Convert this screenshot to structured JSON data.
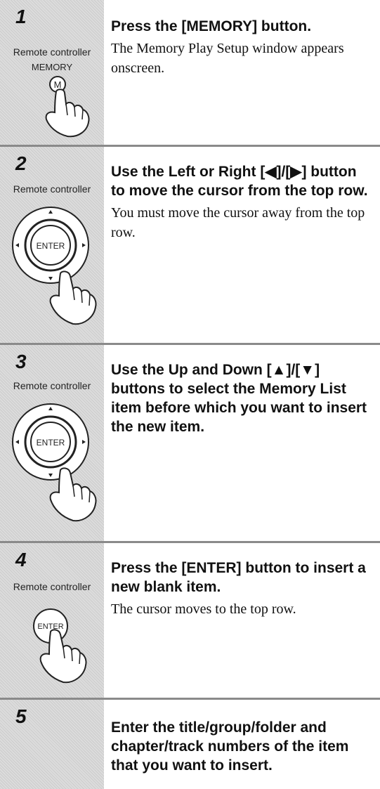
{
  "steps": [
    {
      "number": "1",
      "remote_label": "Remote controller",
      "button_label": "MEMORY",
      "button_letter": "M",
      "heading": "Press the [MEMORY] button.",
      "body": "The Memory Play Setup window appears onscreen."
    },
    {
      "number": "2",
      "remote_label": "Remote controller",
      "enter_label": "ENTER",
      "heading": "Use the Left or Right [◀]/[▶] button to move the cursor from the top row.",
      "body": "You must move the cursor away from the top row."
    },
    {
      "number": "3",
      "remote_label": "Remote controller",
      "enter_label": "ENTER",
      "heading": "Use the Up and Down [▲]/[▼] buttons to select the Memory List item before which you want to insert the new item.",
      "body": ""
    },
    {
      "number": "4",
      "remote_label": "Remote controller",
      "enter_label": "ENTER",
      "heading": "Press the [ENTER] button to insert a new blank item.",
      "body": "The cursor moves to the top row."
    },
    {
      "number": "5",
      "heading": "Enter the title/group/folder and chapter/track numbers of the item that you want to insert.",
      "body": ""
    }
  ]
}
